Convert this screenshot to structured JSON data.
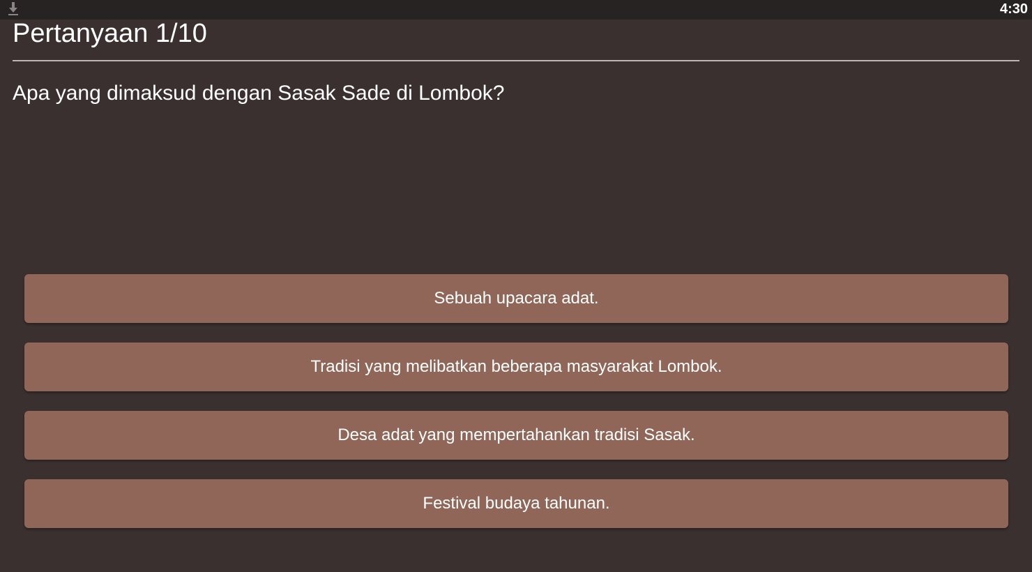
{
  "status_bar": {
    "time": "4:30",
    "notification_icon": "download-icon"
  },
  "quiz": {
    "title": "Pertanyaan 1/10",
    "question": "Apa yang dimaksud dengan Sasak Sade di Lombok?",
    "answers": [
      {
        "label": "Sebuah upacara adat."
      },
      {
        "label": "Tradisi yang melibatkan beberapa masyarakat Lombok."
      },
      {
        "label": "Desa adat yang mempertahankan tradisi Sasak."
      },
      {
        "label": "Festival budaya tahunan."
      }
    ]
  },
  "colors": {
    "background": "#3a302f",
    "status_bar": "#262322",
    "answer_button": "#8f6657",
    "divider": "#bdb6b3",
    "text": "#ffffff"
  }
}
